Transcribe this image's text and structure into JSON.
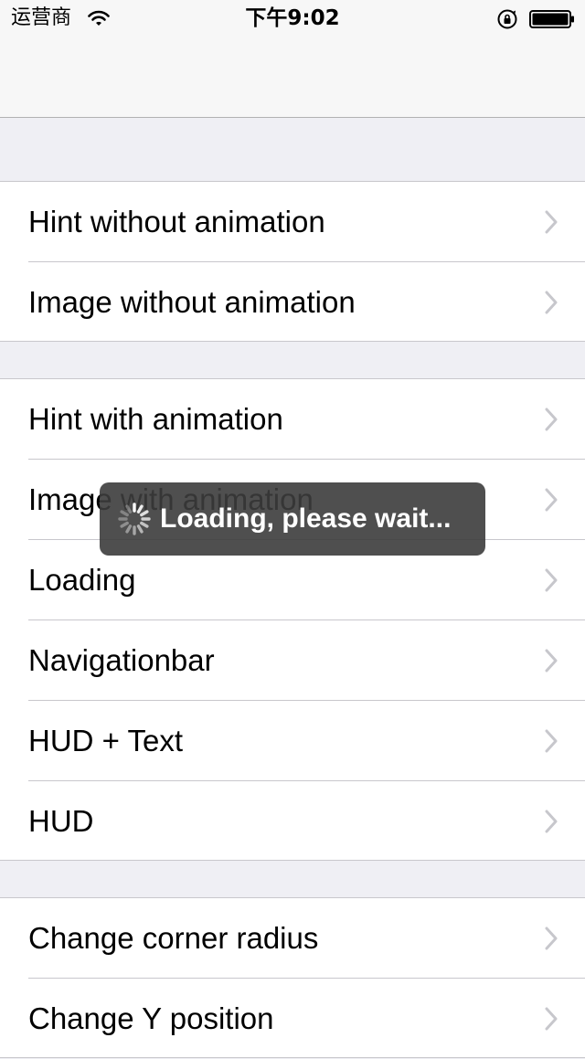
{
  "status_bar": {
    "carrier": "运营商",
    "time": "下午9:02"
  },
  "sections": [
    {
      "items": [
        {
          "label": "Hint without animation"
        },
        {
          "label": "Image without animation"
        }
      ]
    },
    {
      "items": [
        {
          "label": "Hint with animation"
        },
        {
          "label": "Image with animation"
        },
        {
          "label": "Loading"
        },
        {
          "label": "Navigationbar"
        },
        {
          "label": "HUD + Text"
        },
        {
          "label": "HUD"
        }
      ]
    },
    {
      "items": [
        {
          "label": "Change corner radius"
        },
        {
          "label": "Change Y position"
        }
      ]
    }
  ],
  "toast": {
    "text": "Loading, please wait..."
  }
}
